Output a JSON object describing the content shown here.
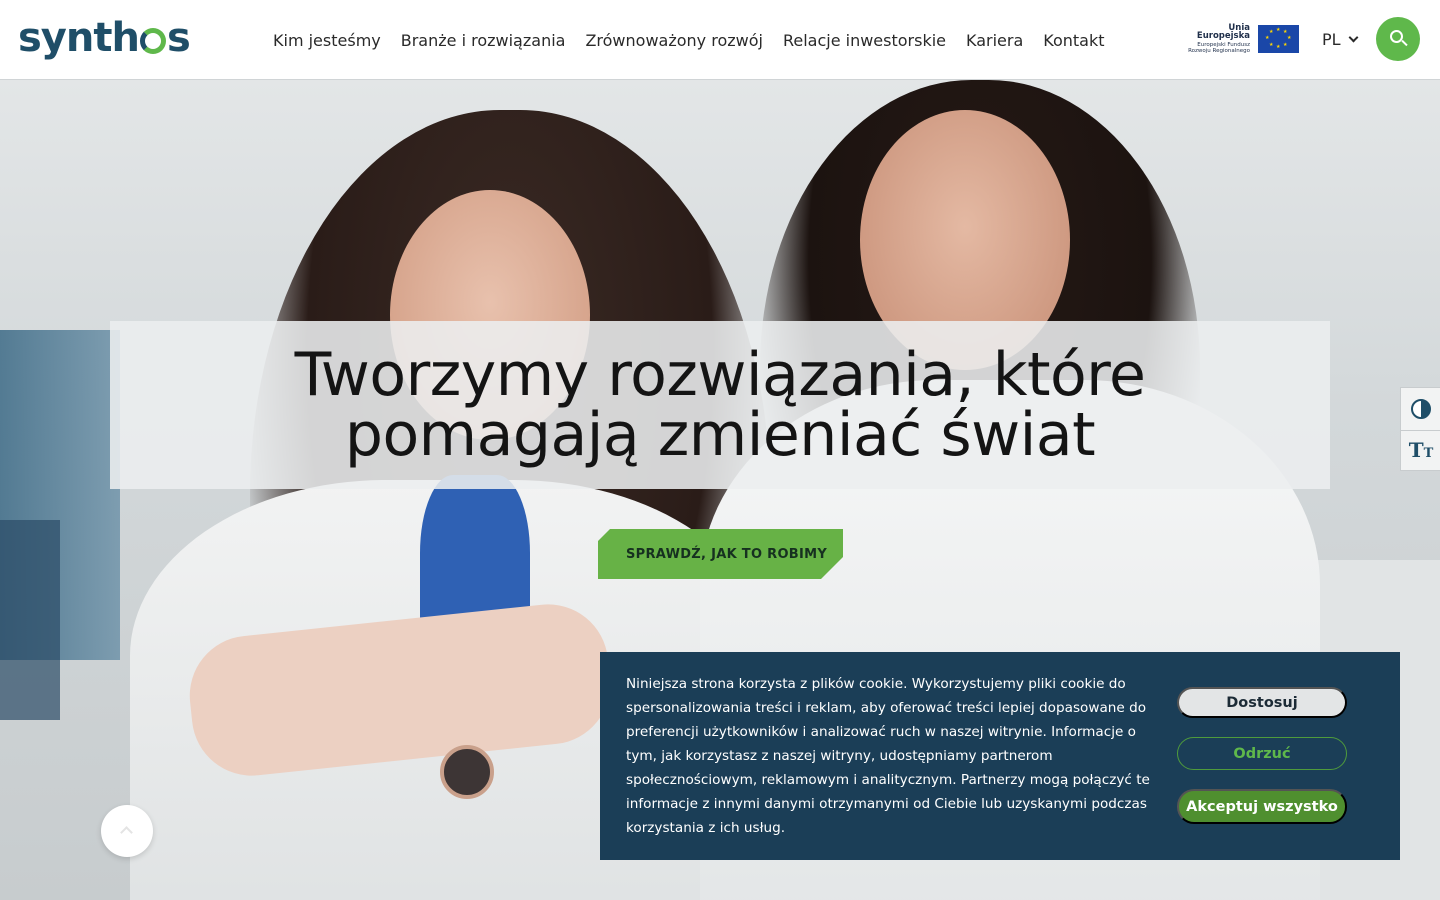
{
  "header": {
    "logo_text_a": "synth",
    "logo_text_b": "s",
    "nav": [
      {
        "label": "Kim jesteśmy"
      },
      {
        "label": "Branże i rozwiązania"
      },
      {
        "label": "Zrównoważony rozwój"
      },
      {
        "label": "Relacje inwestorskie"
      },
      {
        "label": "Kariera"
      },
      {
        "label": "Kontakt"
      }
    ],
    "eu_badge": {
      "title": "Unia Europejska",
      "subtitle_1": "Europejski Fundusz",
      "subtitle_2": "Rozwoju Regionalnego"
    },
    "language": "PL",
    "search_icon": "search-icon",
    "accent_color": "#5fb84b",
    "brand_color": "#1f4e68"
  },
  "hero": {
    "title": "Tworzymy rozwiązania, które pomagają zmieniać świat",
    "cta_label": "SPRAWDŹ, JAK TO ROBIMY"
  },
  "accessibility": {
    "contrast_icon": "contrast-icon",
    "text_size_icon": "text-size-icon"
  },
  "cookie_banner": {
    "text": "Niniejsza strona korzysta z plików cookie. Wykorzystujemy pliki cookie do spersonalizowania treści i reklam, aby oferować treści lepiej dopasowane do preferencji użytkowników i analizować ruch w naszej witrynie. Informacje o tym, jak korzystasz z naszej witryny, udostępniamy partnerom społecznościowym, reklamowym i analitycznym. Partnerzy mogą połączyć te informacje z innymi danymi otrzymanymi od Ciebie lub uzyskanymi podczas korzystania z ich usług.",
    "customize_label": "Dostosuj",
    "reject_label": "Odrzuć",
    "accept_label": "Akceptuj wszystko",
    "background_color": "#1b3e57"
  }
}
